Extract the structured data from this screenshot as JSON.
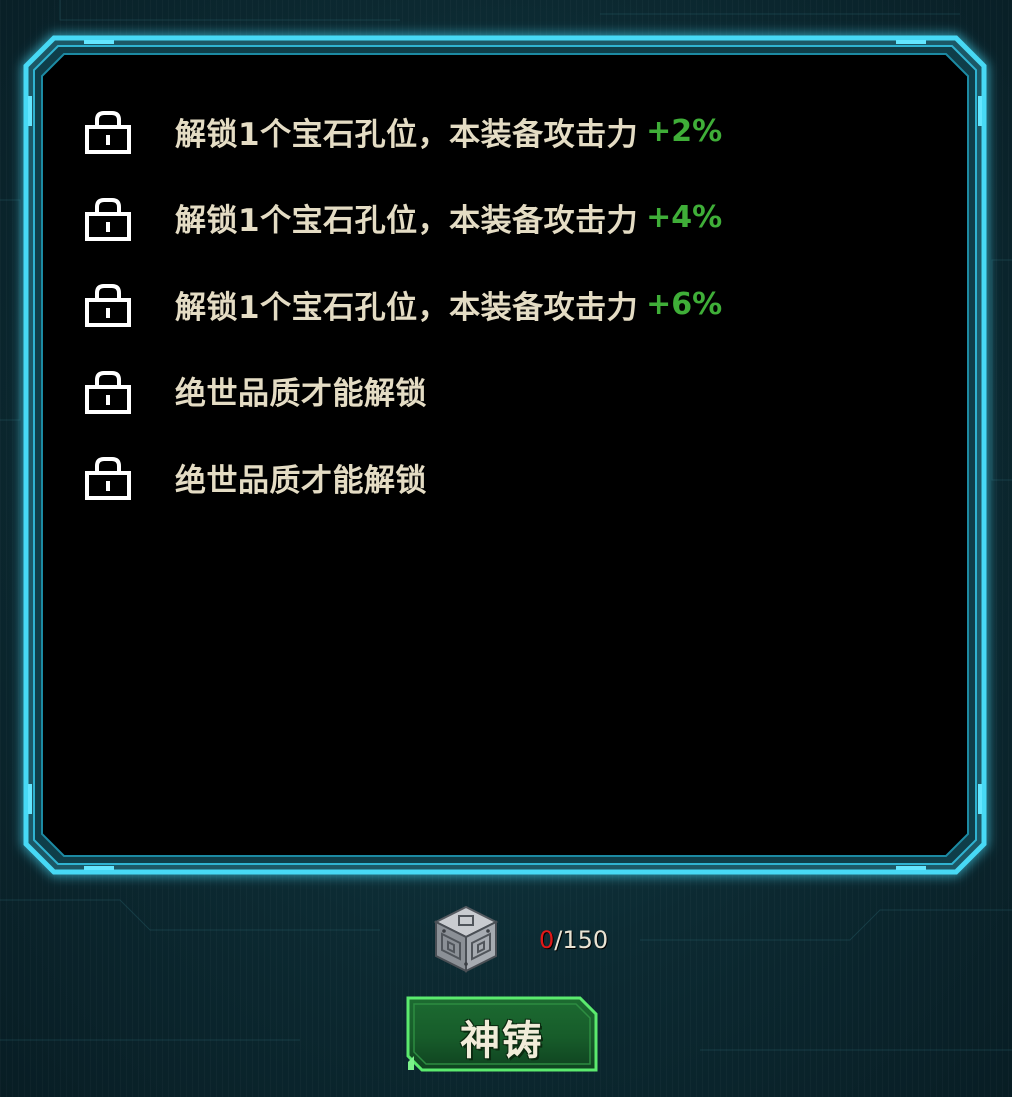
{
  "sockets": [
    {
      "text": "解锁1个宝石孔位，本装备攻击力",
      "bonus": "+2%"
    },
    {
      "text": "解锁1个宝石孔位，本装备攻击力",
      "bonus": "+4%"
    },
    {
      "text": "解锁1个宝石孔位，本装备攻击力",
      "bonus": "+6%"
    },
    {
      "text": "绝世品质才能解锁",
      "bonus": ""
    },
    {
      "text": "绝世品质才能解锁",
      "bonus": ""
    }
  ],
  "cost": {
    "current": "0",
    "required": "/150",
    "item_icon": "metal-cube-icon"
  },
  "forge_button": {
    "label": "神铸"
  },
  "icons": {
    "lock": "lock-icon"
  },
  "colors": {
    "frame_glow": "#3fd2f2",
    "text": "#e4dcc4",
    "bonus": "#3fae38",
    "insufficient": "#e01818",
    "button_green": "#1f7a35"
  }
}
